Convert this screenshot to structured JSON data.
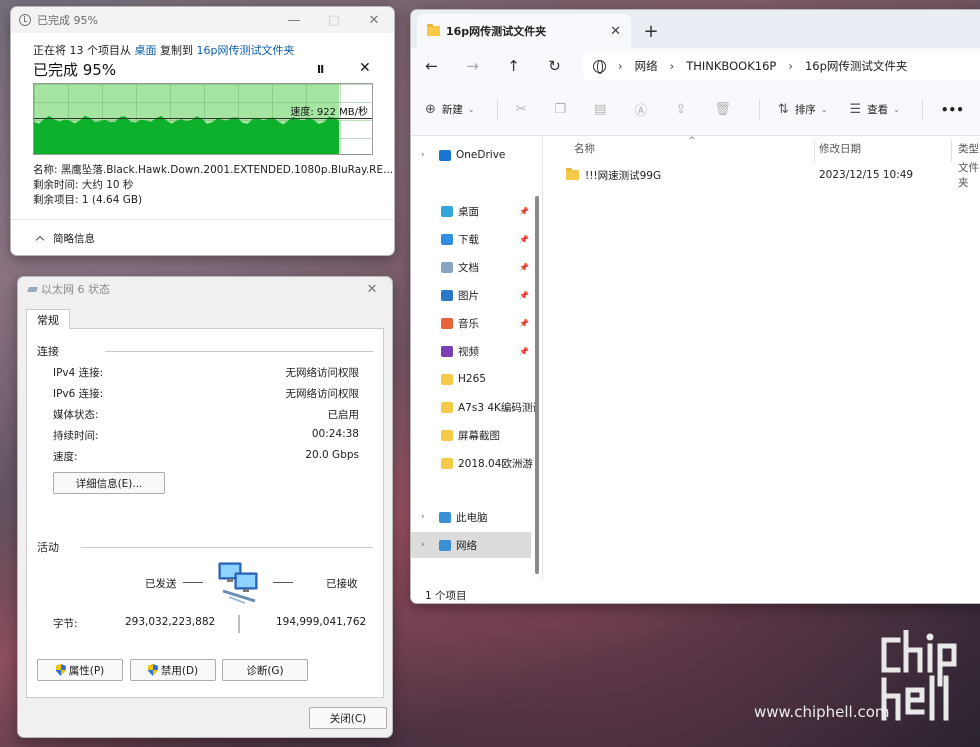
{
  "copy_dialog": {
    "title": "已完成 95%",
    "desc_prefix": "正在将 13 个项目从 ",
    "from": "桌面",
    "desc_mid": " 复制到 ",
    "to": "16p网传测试文件夹",
    "percent": "已完成 95%",
    "progress_fraction": 0.95,
    "speed": "速度: 922 MB/秒",
    "name": "名称: 黑鹰坠落.Black.Hawk.Down.2001.EXTENDED.1080p.BluRay.RE...",
    "time_left": "剩余时间: 大约 10 秒",
    "items_left": "剩余项目: 1 (4.64 GB)",
    "brief": "简略信息",
    "pause_glyph": "II",
    "close_glyph": "✕"
  },
  "ethernet": {
    "title": "以太网 6 状态",
    "tab": "常规",
    "connection_title": "连接",
    "rows": [
      {
        "label": "IPv4 连接:",
        "value": "无网络访问权限"
      },
      {
        "label": "IPv6 连接:",
        "value": "无网络访问权限"
      },
      {
        "label": "媒体状态:",
        "value": "已启用"
      },
      {
        "label": "持续时间:",
        "value": "00:24:38"
      },
      {
        "label": "速度:",
        "value": "20.0 Gbps"
      }
    ],
    "details_button": "详细信息(E)...",
    "activity_title": "活动",
    "sent_label": "已发送",
    "received_label": "已接收",
    "bytes_label": "字节:",
    "bytes_sent": "293,032,223,882",
    "bytes_received": "194,999,041,762",
    "properties_button": "属性(P)",
    "disable_button": "禁用(D)",
    "diagnose_button": "诊断(G)",
    "close_button": "关闭(C)"
  },
  "explorer": {
    "tab_title": "16p网传测试文件夹",
    "tab_close": "✕",
    "new_tab": "+",
    "path": [
      "网络",
      "THINKBOOK16P",
      "16p网传测试文件夹"
    ],
    "toolbar": {
      "new": "新建",
      "sort": "排序",
      "view": "查看",
      "more": "•••"
    },
    "nav": [
      {
        "label": "OneDrive",
        "type": "onedrive"
      },
      {
        "label": "桌面",
        "type": "desktop",
        "pinned": true
      },
      {
        "label": "下载",
        "type": "download",
        "pinned": true
      },
      {
        "label": "文档",
        "type": "docs",
        "pinned": true
      },
      {
        "label": "图片",
        "type": "pictures",
        "pinned": true
      },
      {
        "label": "音乐",
        "type": "music",
        "pinned": true
      },
      {
        "label": "视频",
        "type": "video",
        "pinned": true
      },
      {
        "label": "H265",
        "type": "folder"
      },
      {
        "label": "A7s3 4K编码测试",
        "type": "folder"
      },
      {
        "label": "屏幕截图",
        "type": "folder"
      },
      {
        "label": "2018.04欧洲游",
        "type": "folder"
      },
      {
        "label": "此电脑",
        "type": "pc"
      },
      {
        "label": "网络",
        "type": "network",
        "selected": true
      }
    ],
    "columns": {
      "name": "名称",
      "date": "修改日期",
      "type": "类型"
    },
    "files": [
      {
        "name": "!!!网速测试99G",
        "date": "2023/12/15 10:49",
        "type": "文件夹"
      }
    ],
    "status": "1 个项目"
  },
  "watermark": "www.chiphell.com",
  "colors": {
    "progress_green": "#0db12c",
    "progress_light": "#a6e4a1",
    "link": "#0b5cad"
  }
}
